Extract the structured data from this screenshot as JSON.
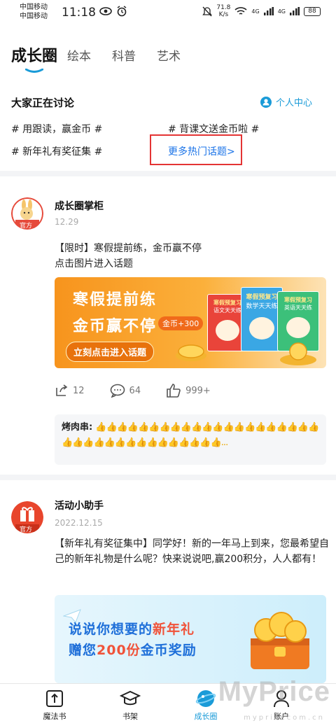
{
  "status": {
    "carrier1": "中国移动",
    "carrier2": "中国移动",
    "time": "11:18",
    "net_speed_value": "71.8",
    "net_speed_unit": "K/s",
    "signal1": "4G",
    "signal2": "4G",
    "battery": "88"
  },
  "tabs": [
    {
      "label": "成长圈",
      "active": true
    },
    {
      "label": "绘本"
    },
    {
      "label": "科普"
    },
    {
      "label": "艺术"
    }
  ],
  "discuss": {
    "title": "大家正在讨论",
    "personal_center": "个人中心",
    "topics": [
      "# 用跟读，赢金币 #",
      "# 背课文送金币啦 #",
      "# 新年礼有奖征集 #"
    ],
    "more": "更多热门话题>"
  },
  "posts": [
    {
      "author": "成长圈掌柜",
      "badge": "官方",
      "date": "12.29",
      "text_line1": "【限时】寒假提前练，金币赢不停",
      "text_line2": "点击图片进入话题",
      "banner": {
        "headline1": "寒假提前练",
        "headline2": "金币赢不停",
        "coin_tag": "金币+300",
        "cta": "立刻点击进入话题",
        "book1_title": "寒假预复习",
        "book1_sub": "语文天天练",
        "book2_title": "寒假预复习",
        "book2_sub": "数学天天练",
        "book3_title": "寒假预复习",
        "book3_sub": "英语天天练"
      },
      "shares": "12",
      "comments": "64",
      "likes": "999+",
      "comment": {
        "name": "烤肉串:",
        "content": "👍👍👍👍👍👍👍👍👍👍👍👍👍👍👍👍👍👍👍👍👍👍👍👍👍👍👍👍👍👍👍👍👍👍👍👍..."
      }
    },
    {
      "author": "活动小助手",
      "badge": "官方",
      "date": "2022.12.15",
      "text": "【新年礼有奖征集中】同学好！新的一年马上到来，您最希望自己的新年礼物是什么呢？快来说说吧,赢200积分，人人都有！",
      "banner": {
        "line1_a": "说说你想要的",
        "line1_b": "新年礼",
        "line2_a": "赠您",
        "line2_b": "200份",
        "line2_c": "金币奖励"
      }
    }
  ],
  "bottom_nav": [
    {
      "label": "魔法书",
      "icon": "book-icon"
    },
    {
      "label": "书架",
      "icon": "graduation-cap-icon"
    },
    {
      "label": "成长圈",
      "icon": "planet-icon",
      "active": true
    },
    {
      "label": "账户",
      "icon": "person-icon"
    }
  ],
  "watermark": {
    "text": "MyPrice",
    "url": "mypricecom.cn"
  },
  "colors": {
    "accent": "#1a9bd8",
    "link": "#1a73e8",
    "highlight_border": "#e43434",
    "banner1_orange": "#f7941d",
    "banner2_blue": "#dff3fb"
  }
}
